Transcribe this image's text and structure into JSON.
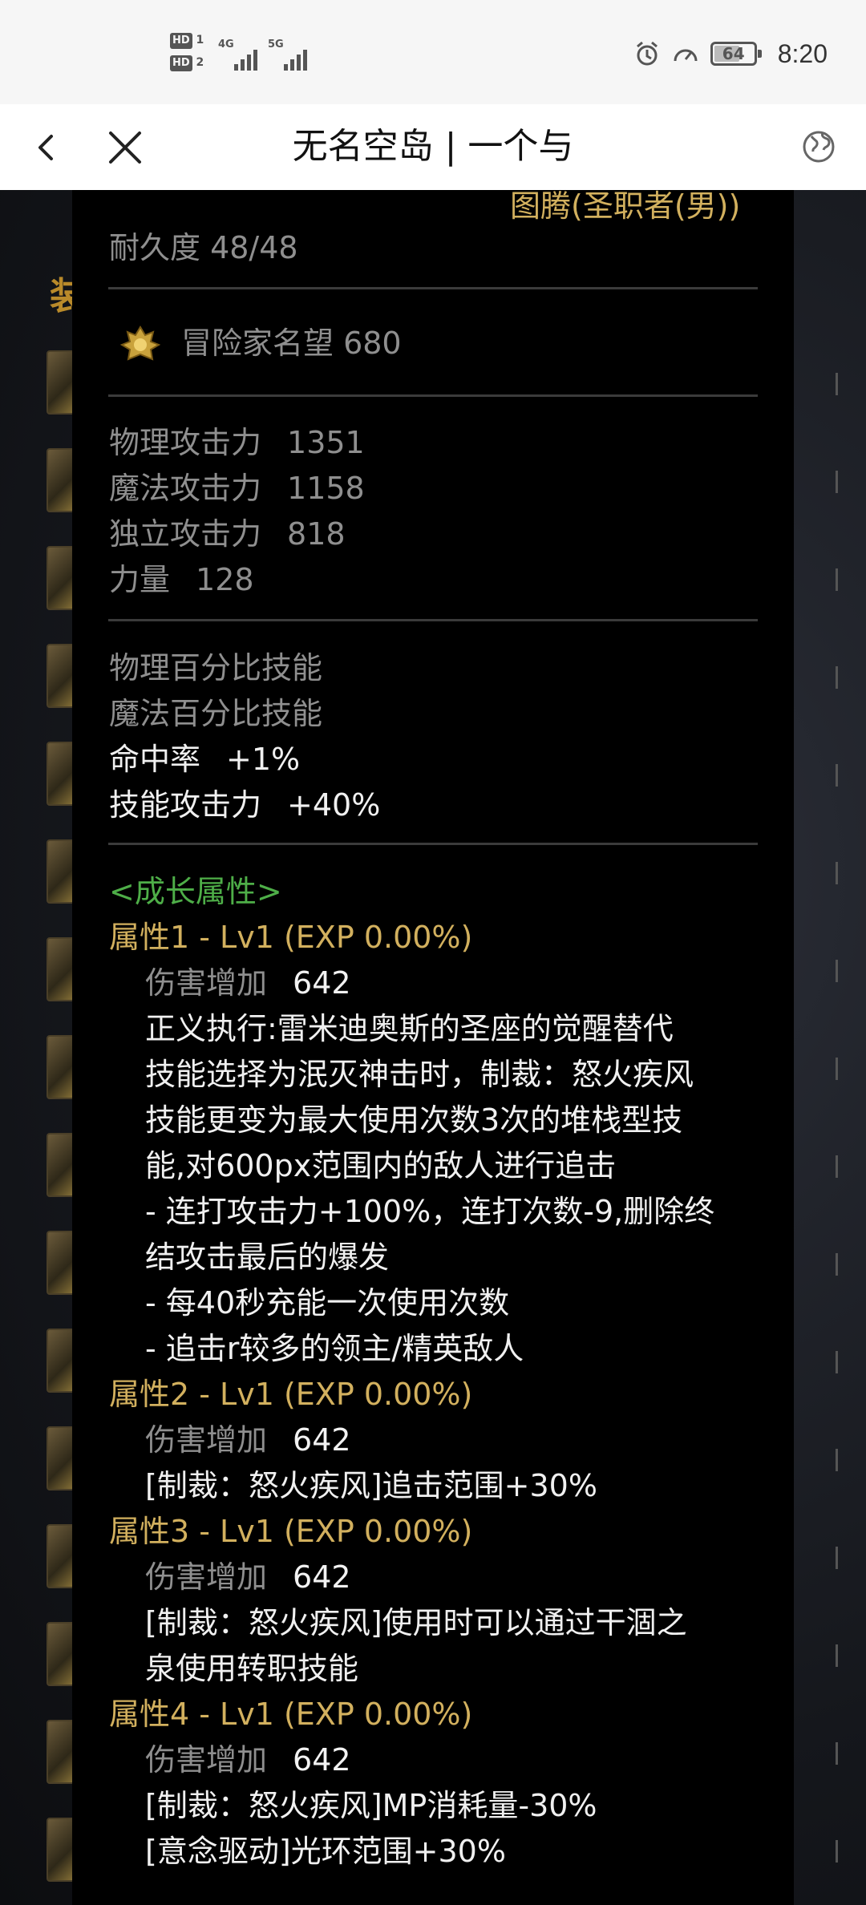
{
  "status_bar": {
    "sim1_label": "HD",
    "sim1_index": "1",
    "sim2_label": "HD",
    "sim2_index": "2",
    "net1": "4G",
    "net2": "5G",
    "battery": "64",
    "time": "8:20"
  },
  "title_bar": {
    "title": "无名空岛 | 一个与"
  },
  "background": {
    "heading": "装"
  },
  "tooltip": {
    "class_line": "图腾(圣职者(男))",
    "durability": "耐久度 48/48",
    "reputation": "冒险家名望 680",
    "stats": [
      {
        "label": "物理攻击力",
        "value": "1351"
      },
      {
        "label": "魔法攻击力",
        "value": "1158"
      },
      {
        "label": "独立攻击力",
        "value": "818"
      },
      {
        "label": "力量",
        "value": "128"
      }
    ],
    "skill_lines": {
      "phys_pct": "物理百分比技能",
      "mag_pct": "魔法百分比技能",
      "hit_label": "命中率",
      "hit_value": "+1%",
      "skill_atk_label": "技能攻击力",
      "skill_atk_value": "+40%"
    },
    "growth_header": "<成长属性>",
    "attr1": {
      "title": "属性1 - Lv1 (EXP 0.00%)",
      "dmg_label": "伤害增加",
      "dmg_value": "642",
      "desc": [
        "正义执行:雷米迪奥斯的圣座的觉醒替代",
        "技能选择为泯灭神击时，制裁：怒火疾风",
        "技能更变为最大使用次数3次的堆栈型技",
        "能,对600px范围内的敌人进行追击",
        "- 连打攻击力+100%，连打次数-9,删除终",
        "结攻击最后的爆发",
        "- 每40秒充能一次使用次数",
        "- 追击r较多的领主/精英敌人"
      ]
    },
    "attr2": {
      "title": "属性2 - Lv1 (EXP 0.00%)",
      "dmg_label": "伤害增加",
      "dmg_value": "642",
      "desc": [
        "[制裁：怒火疾风]追击范围+30%"
      ]
    },
    "attr3": {
      "title": "属性3 - Lv1 (EXP 0.00%)",
      "dmg_label": "伤害增加",
      "dmg_value": "642",
      "desc": [
        "[制裁：怒火疾风]使用时可以通过干涸之",
        "泉使用转职技能"
      ]
    },
    "attr4": {
      "title": "属性4 - Lv1 (EXP 0.00%)",
      "dmg_label": "伤害增加",
      "dmg_value": "642",
      "desc": [
        "[制裁：怒火疾风]MP消耗量-30%",
        "[意念驱动]光环范围+30%"
      ]
    }
  }
}
